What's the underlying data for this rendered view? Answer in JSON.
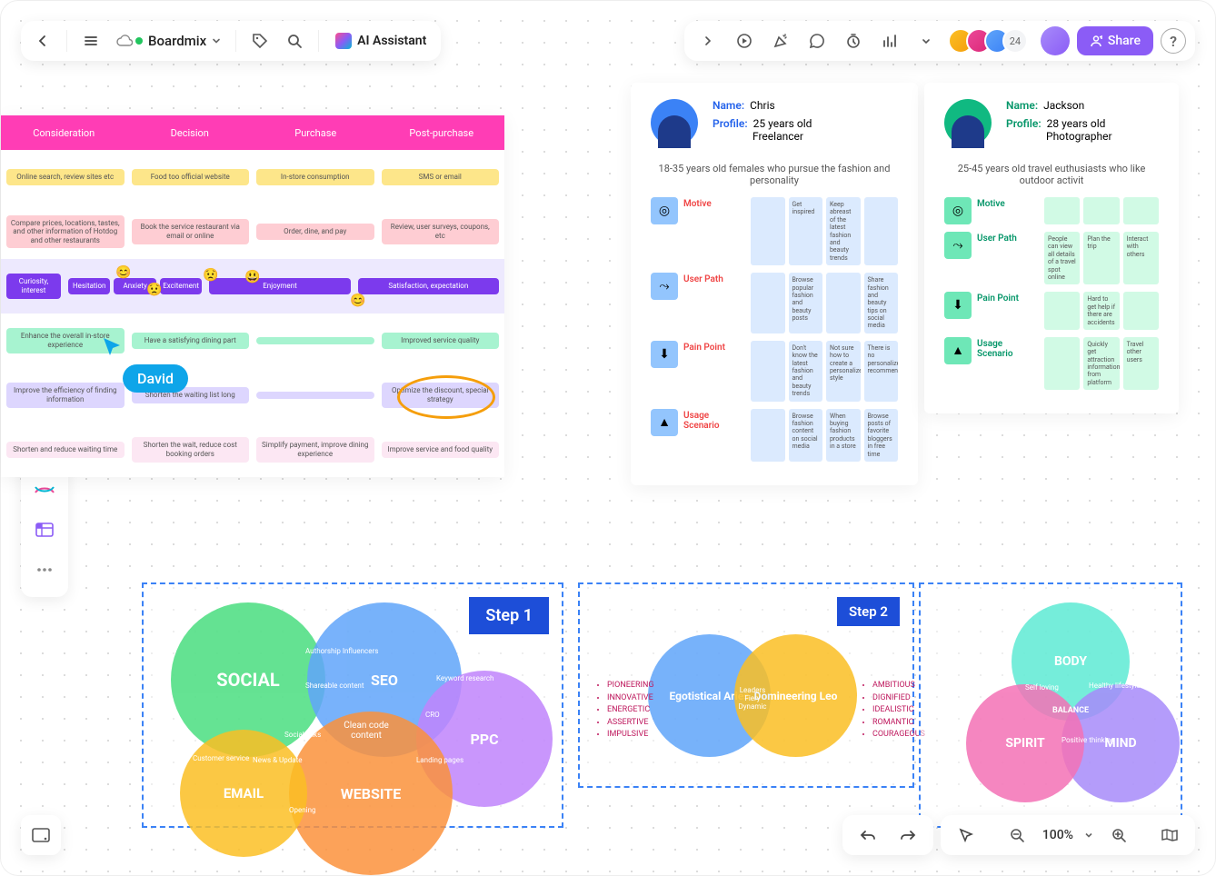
{
  "header": {
    "title": "Boardmix",
    "ai_label": "AI Assistant",
    "collab_count": "24",
    "share_label": "Share"
  },
  "collab_cursor": {
    "name": "David"
  },
  "zoom": {
    "value": "100%"
  },
  "journey": {
    "headers": [
      "Consideration",
      "Decision",
      "Purchase",
      "Post-purchase"
    ],
    "rows": [
      {
        "cls": "j-yellow",
        "cells": [
          "Online search, review sites etc",
          "Food too official website",
          "In-store consumption",
          "SMS  or email"
        ]
      },
      {
        "cls": "j-pink",
        "cells": [
          "Compare prices, locations, tastes, and other information of Hotdog and other restaurants",
          "Book the service restaurant via email or online",
          "Order, dine, and pay",
          "Review, user surveys, coupons, etc"
        ]
      },
      {
        "cls": "j-purple",
        "cells_split": [
          [
            "Curiosity, interest"
          ],
          [
            "Hesitation",
            "Anxiety",
            "Excitement"
          ],
          [
            "Enjoyment"
          ],
          [
            "Satisfaction, expectation"
          ]
        ]
      },
      {
        "cls": "j-green",
        "cells": [
          "Enhance the overall in-store experience",
          "Have a satisfying dining part",
          "",
          "Improved service quality"
        ]
      },
      {
        "cls": "j-purpleL",
        "cells": [
          "Improve the efficiency of finding information",
          "Shorten the waiting list long",
          "",
          "Optimize the discount, special strategy"
        ]
      },
      {
        "cls": "j-pinkL",
        "cells": [
          "Shorten and reduce waiting time",
          "Shorten the wait, reduce cost booking orders",
          "Simplify payment, improve dining experience",
          "Improve service and food quality"
        ]
      }
    ]
  },
  "personas": [
    {
      "name": "Chris",
      "profile_line1": "25 years old",
      "profile_line2": "Freelancer",
      "desc": "18-35 years old females who pursue the fashion and personality",
      "sections": [
        {
          "icon": "◎",
          "label": "Motive",
          "cards": [
            "",
            "Get inspired",
            "Keep abreast of the latest fashion and beauty trends",
            ""
          ]
        },
        {
          "icon": "⤳",
          "label": "User Path",
          "cards": [
            "",
            "Browse popular fashion and beauty posts",
            "",
            "Share fashion and beauty tips on social media"
          ]
        },
        {
          "icon": "⬇",
          "label": "Pain Point",
          "cards": [
            "",
            "Don't know the latest fashion and beauty trends",
            "Not sure how to create a personalized style",
            "There is no personalized recommendation"
          ]
        },
        {
          "icon": "▲",
          "label": "Usage Scenario",
          "cards": [
            "",
            "Browse fashion content on social media",
            "When buying fashion products in a store",
            "Browse posts of favorite bloggers in free time"
          ]
        }
      ]
    },
    {
      "name": "Jackson",
      "profile_line1": "28 years old",
      "profile_line2": "Photographer",
      "desc": "25-45 years old travel euthusiasts who like outdoor activit",
      "sections": [
        {
          "icon": "◎",
          "label": "Motive",
          "cards": [
            "",
            "",
            ""
          ]
        },
        {
          "icon": "⤳",
          "label": "User Path",
          "cards": [
            "People can view all details of a travel spot online",
            "Plan the trip",
            "Interact with others"
          ]
        },
        {
          "icon": "⬇",
          "label": "Pain Point",
          "cards": [
            "",
            "Hard to get help if there are accidents",
            ""
          ]
        },
        {
          "icon": "▲",
          "label": "Usage Scenario",
          "cards": [
            "",
            "Quickly get attraction information from platform",
            "Travel other users"
          ]
        }
      ]
    }
  ],
  "venn": {
    "step1": {
      "badge": "Step 1",
      "circles": [
        "SOCIAL",
        "SEO",
        "PPC",
        "WEBSITE",
        "EMAIL"
      ],
      "center": "Clean code content",
      "labels": [
        "Authorship Influencers",
        "Shareable content",
        "Keyword research",
        "CRO",
        "Landing pages",
        "Social links",
        "News & Update",
        "Opening",
        "Customer service"
      ]
    },
    "step2": {
      "badge": "Step 2",
      "left_circle": "Egotistical Aries",
      "right_circle": "Domineering Leo",
      "center": "Leaders Fiery Dynamic",
      "left_list": [
        "PIONEERING",
        "INNOVATIVE",
        "ENERGETIC",
        "ASSERTIVE",
        "IMPULSIVE"
      ],
      "right_list": [
        "AMBITIOUS",
        "DIGNIFIED",
        "IDEALISTIC",
        "ROMANTIC",
        "COURAGEOUS"
      ]
    },
    "step3": {
      "circles": [
        "BODY",
        "MIND",
        "SPIRIT"
      ],
      "center": "BALANCE",
      "labels": [
        "Self loving",
        "Healthy lifestyle",
        "Positive thinking"
      ]
    }
  },
  "labels": {
    "name": "Name:",
    "profile": "Profile:"
  }
}
